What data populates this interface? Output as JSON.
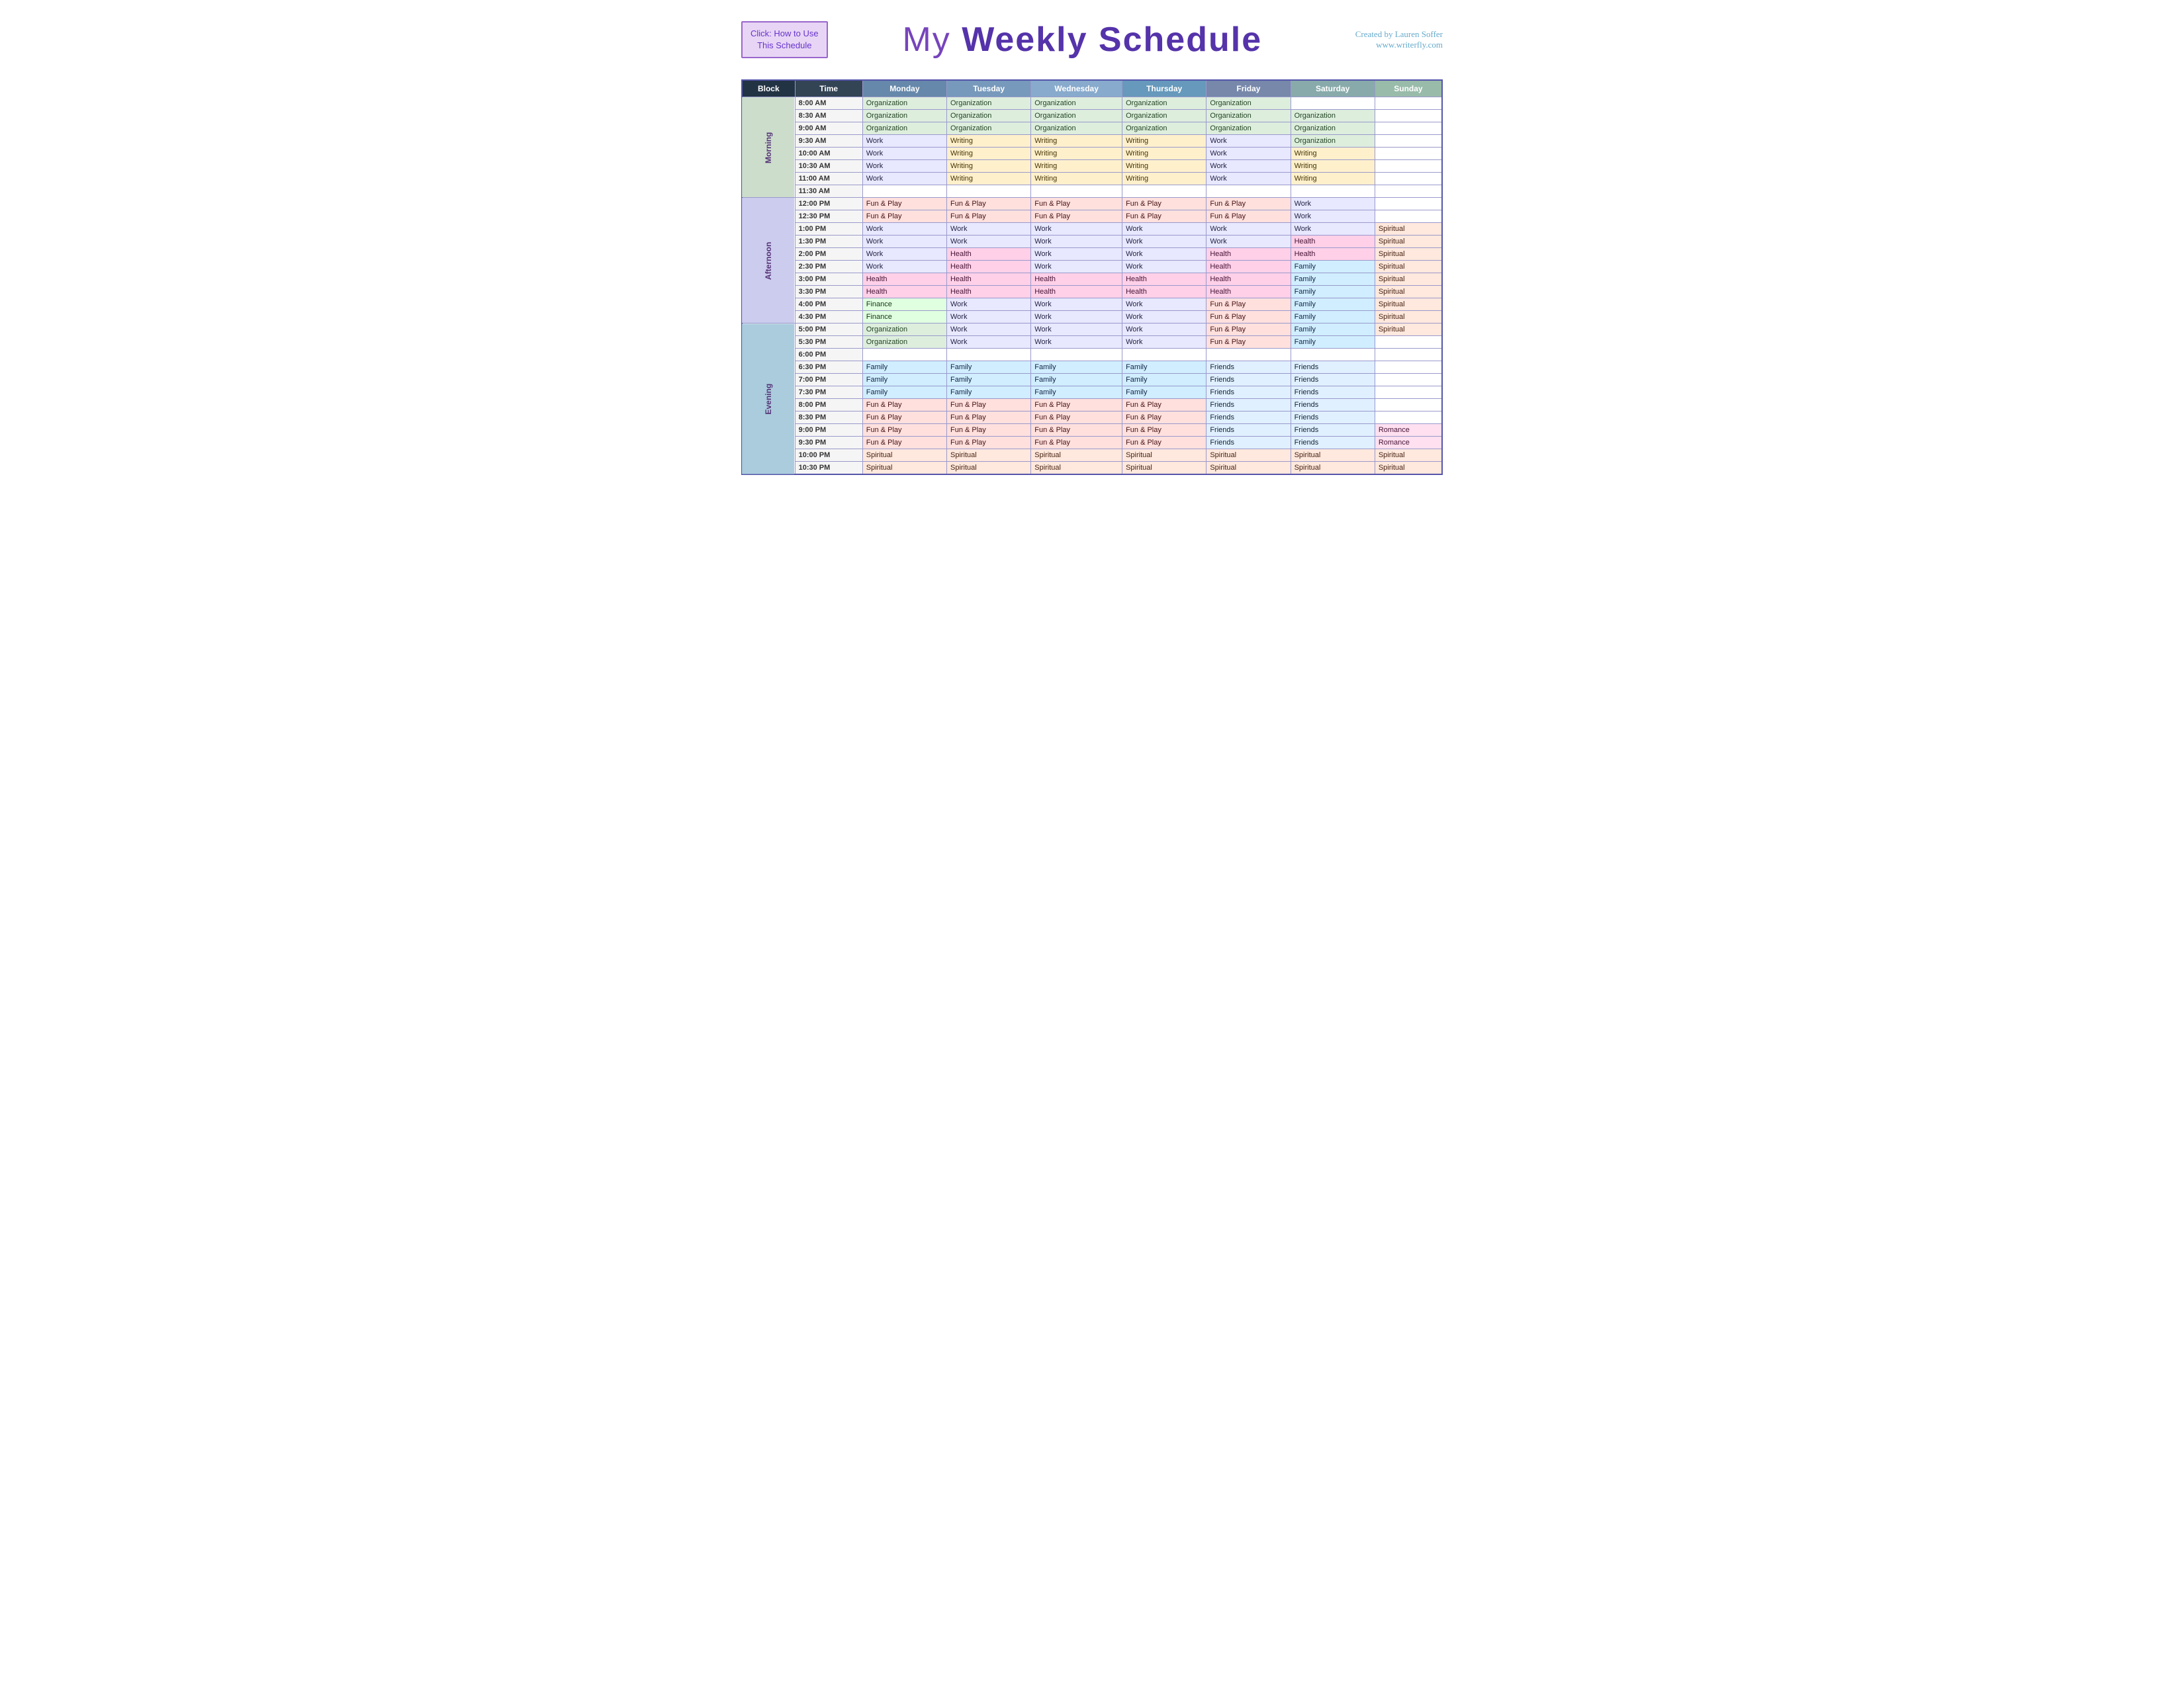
{
  "header": {
    "click_label": "Click:  How to Use\nThis Schedule",
    "title": "My Weekly Schedule",
    "credit_line1": "Created by Lauren Soffer",
    "credit_line2": "www.writerfly.com"
  },
  "table": {
    "columns": [
      "Block",
      "Time",
      "Monday",
      "Tuesday",
      "Wednesday",
      "Thursday",
      "Friday",
      "Saturday",
      "Sunday"
    ],
    "rows": [
      {
        "block": "Morning",
        "time": "8:00 AM",
        "mon": "Organization",
        "tue": "Organization",
        "wed": "Organization",
        "thu": "Organization",
        "fri": "Organization",
        "sat": "",
        "sun": ""
      },
      {
        "block": "Morning",
        "time": "8:30 AM",
        "mon": "Organization",
        "tue": "Organization",
        "wed": "Organization",
        "thu": "Organization",
        "fri": "Organization",
        "sat": "Organization",
        "sun": ""
      },
      {
        "block": "Morning",
        "time": "9:00 AM",
        "mon": "Organization",
        "tue": "Organization",
        "wed": "Organization",
        "thu": "Organization",
        "fri": "Organization",
        "sat": "Organization",
        "sun": ""
      },
      {
        "block": "Morning",
        "time": "9:30 AM",
        "mon": "Work",
        "tue": "Writing",
        "wed": "Writing",
        "thu": "Writing",
        "fri": "Work",
        "sat": "Organization",
        "sun": ""
      },
      {
        "block": "Morning",
        "time": "10:00 AM",
        "mon": "Work",
        "tue": "Writing",
        "wed": "Writing",
        "thu": "Writing",
        "fri": "Work",
        "sat": "Writing",
        "sun": ""
      },
      {
        "block": "Morning",
        "time": "10:30 AM",
        "mon": "Work",
        "tue": "Writing",
        "wed": "Writing",
        "thu": "Writing",
        "fri": "Work",
        "sat": "Writing",
        "sun": ""
      },
      {
        "block": "Morning",
        "time": "11:00 AM",
        "mon": "Work",
        "tue": "Writing",
        "wed": "Writing",
        "thu": "Writing",
        "fri": "Work",
        "sat": "Writing",
        "sun": ""
      },
      {
        "block": "Morning",
        "time": "11:30 AM",
        "mon": "",
        "tue": "",
        "wed": "",
        "thu": "",
        "fri": "",
        "sat": "",
        "sun": ""
      },
      {
        "block": "Afternoon",
        "time": "12:00 PM",
        "mon": "Fun & Play",
        "tue": "Fun & Play",
        "wed": "Fun & Play",
        "thu": "Fun & Play",
        "fri": "Fun & Play",
        "sat": "Work",
        "sun": ""
      },
      {
        "block": "Afternoon",
        "time": "12:30 PM",
        "mon": "Fun & Play",
        "tue": "Fun & Play",
        "wed": "Fun & Play",
        "thu": "Fun & Play",
        "fri": "Fun & Play",
        "sat": "Work",
        "sun": ""
      },
      {
        "block": "Afternoon",
        "time": "1:00 PM",
        "mon": "Work",
        "tue": "Work",
        "wed": "Work",
        "thu": "Work",
        "fri": "Work",
        "sat": "Work",
        "sun": "Spiritual"
      },
      {
        "block": "Afternoon",
        "time": "1:30 PM",
        "mon": "Work",
        "tue": "Work",
        "wed": "Work",
        "thu": "Work",
        "fri": "Work",
        "sat": "Health",
        "sun": "Spiritual"
      },
      {
        "block": "Afternoon",
        "time": "2:00 PM",
        "mon": "Work",
        "tue": "Health",
        "wed": "Work",
        "thu": "Work",
        "fri": "Health",
        "sat": "Health",
        "sun": "Spiritual"
      },
      {
        "block": "Afternoon",
        "time": "2:30 PM",
        "mon": "Work",
        "tue": "Health",
        "wed": "Work",
        "thu": "Work",
        "fri": "Health",
        "sat": "Family",
        "sun": "Spiritual"
      },
      {
        "block": "Afternoon",
        "time": "3:00 PM",
        "mon": "Health",
        "tue": "Health",
        "wed": "Health",
        "thu": "Health",
        "fri": "Health",
        "sat": "Family",
        "sun": "Spiritual"
      },
      {
        "block": "Afternoon",
        "time": "3:30 PM",
        "mon": "Health",
        "tue": "Health",
        "wed": "Health",
        "thu": "Health",
        "fri": "Health",
        "sat": "Family",
        "sun": "Spiritual"
      },
      {
        "block": "Afternoon",
        "time": "4:00 PM",
        "mon": "Finance",
        "tue": "Work",
        "wed": "Work",
        "thu": "Work",
        "fri": "Fun & Play",
        "sat": "Family",
        "sun": "Spiritual"
      },
      {
        "block": "Afternoon",
        "time": "4:30 PM",
        "mon": "Finance",
        "tue": "Work",
        "wed": "Work",
        "thu": "Work",
        "fri": "Fun & Play",
        "sat": "Family",
        "sun": "Spiritual"
      },
      {
        "block": "Evening",
        "time": "5:00 PM",
        "mon": "Organization",
        "tue": "Work",
        "wed": "Work",
        "thu": "Work",
        "fri": "Fun & Play",
        "sat": "Family",
        "sun": "Spiritual"
      },
      {
        "block": "Evening",
        "time": "5:30 PM",
        "mon": "Organization",
        "tue": "Work",
        "wed": "Work",
        "thu": "Work",
        "fri": "Fun & Play",
        "sat": "Family",
        "sun": ""
      },
      {
        "block": "Evening",
        "time": "6:00 PM",
        "mon": "",
        "tue": "",
        "wed": "",
        "thu": "",
        "fri": "",
        "sat": "",
        "sun": ""
      },
      {
        "block": "Evening",
        "time": "6:30 PM",
        "mon": "Family",
        "tue": "Family",
        "wed": "Family",
        "thu": "Family",
        "fri": "Friends",
        "sat": "Friends",
        "sun": ""
      },
      {
        "block": "Evening",
        "time": "7:00 PM",
        "mon": "Family",
        "tue": "Family",
        "wed": "Family",
        "thu": "Family",
        "fri": "Friends",
        "sat": "Friends",
        "sun": ""
      },
      {
        "block": "Evening",
        "time": "7:30 PM",
        "mon": "Family",
        "tue": "Family",
        "wed": "Family",
        "thu": "Family",
        "fri": "Friends",
        "sat": "Friends",
        "sun": ""
      },
      {
        "block": "Evening",
        "time": "8:00 PM",
        "mon": "Fun & Play",
        "tue": "Fun & Play",
        "wed": "Fun & Play",
        "thu": "Fun & Play",
        "fri": "Friends",
        "sat": "Friends",
        "sun": ""
      },
      {
        "block": "Evening",
        "time": "8:30 PM",
        "mon": "Fun & Play",
        "tue": "Fun & Play",
        "wed": "Fun & Play",
        "thu": "Fun & Play",
        "fri": "Friends",
        "sat": "Friends",
        "sun": ""
      },
      {
        "block": "Evening",
        "time": "9:00 PM",
        "mon": "Fun & Play",
        "tue": "Fun & Play",
        "wed": "Fun & Play",
        "thu": "Fun & Play",
        "fri": "Friends",
        "sat": "Friends",
        "sun": "Romance"
      },
      {
        "block": "Evening",
        "time": "9:30 PM",
        "mon": "Fun & Play",
        "tue": "Fun & Play",
        "wed": "Fun & Play",
        "thu": "Fun & Play",
        "fri": "Friends",
        "sat": "Friends",
        "sun": "Romance"
      },
      {
        "block": "Evening",
        "time": "10:00 PM",
        "mon": "Spiritual",
        "tue": "Spiritual",
        "wed": "Spiritual",
        "thu": "Spiritual",
        "fri": "Spiritual",
        "sat": "Spiritual",
        "sun": "Spiritual"
      },
      {
        "block": "Evening",
        "time": "10:30 PM",
        "mon": "Spiritual",
        "tue": "Spiritual",
        "wed": "Spiritual",
        "thu": "Spiritual",
        "fri": "Spiritual",
        "sat": "Spiritual",
        "sun": "Spiritual"
      }
    ]
  }
}
